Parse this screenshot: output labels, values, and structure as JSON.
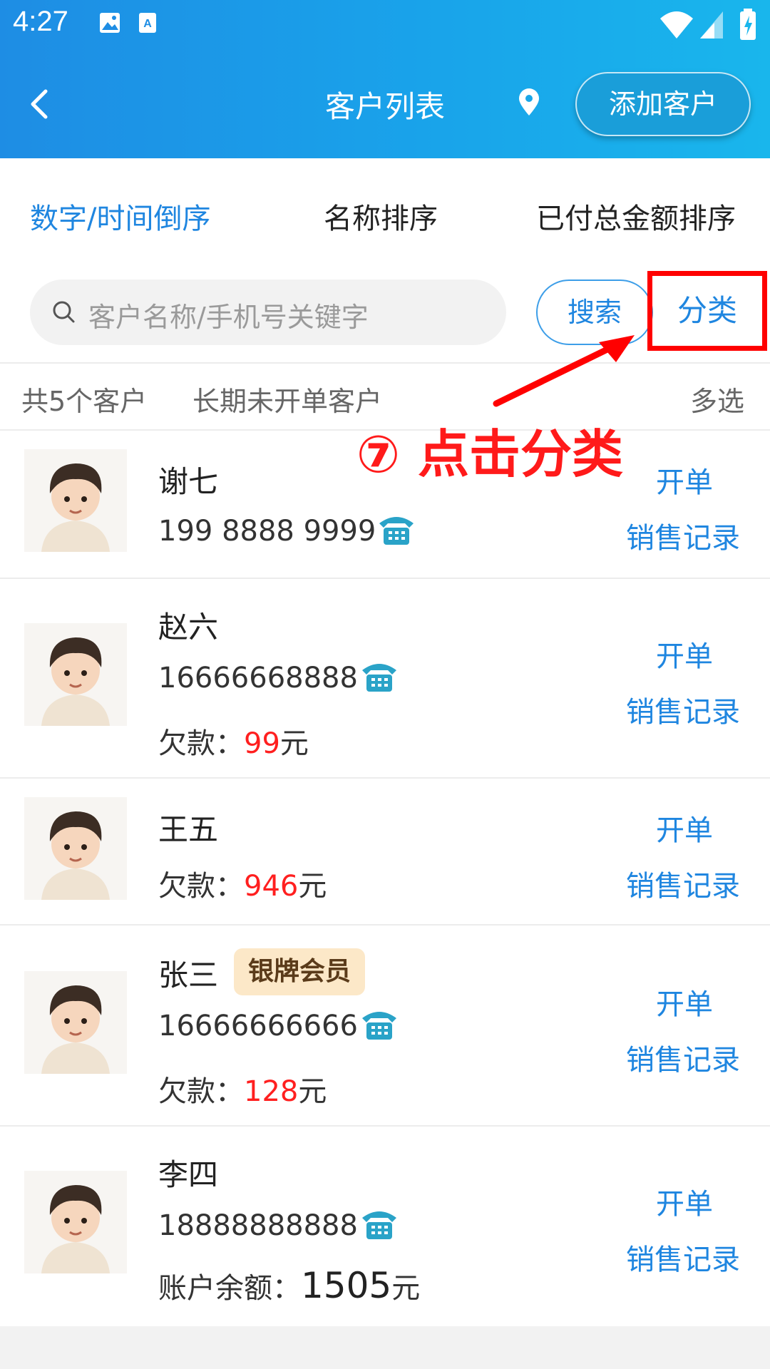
{
  "status_bar": {
    "time": "4:27"
  },
  "header": {
    "title": "客户列表",
    "add_button": "添加客户"
  },
  "sort_tabs": [
    "数字/时间倒序",
    "名称排序",
    "已付总金额排序"
  ],
  "search": {
    "placeholder": "客户名称/手机号关键字",
    "search_button": "搜索",
    "category_button": "分类"
  },
  "summary": {
    "count": "共5个客户",
    "long_inactive": "长期未开单客户",
    "multi_select": "多选"
  },
  "annotation": "⑦ 点击分类",
  "customers": [
    {
      "name": "谢七",
      "phone": "199 8888 9999",
      "badge": "",
      "money_label": "",
      "money_value": "",
      "money_unit": ""
    },
    {
      "name": "赵六",
      "phone": "16666668888",
      "badge": "",
      "money_label": "欠款：",
      "money_value": "99",
      "money_unit": "元"
    },
    {
      "name": "王五",
      "phone": "",
      "badge": "",
      "money_label": "欠款：",
      "money_value": "946",
      "money_unit": "元"
    },
    {
      "name": "张三",
      "phone": "16666666666",
      "badge": "银牌会员",
      "money_label": "欠款：",
      "money_value": "128",
      "money_unit": "元"
    },
    {
      "name": "李四",
      "phone": "18888888888",
      "badge": "",
      "money_label": "账户余额：",
      "money_value": "1505",
      "money_unit": "元"
    }
  ],
  "row_actions": {
    "open_order": "开单",
    "sales_record": "销售记录"
  },
  "colors": {
    "accent_blue": "#1f86e0",
    "debt_red": "#ff1f1f",
    "annotation_red": "#ff0000",
    "header_gradient_start": "#1e8de4",
    "header_gradient_end": "#19b6ec"
  }
}
